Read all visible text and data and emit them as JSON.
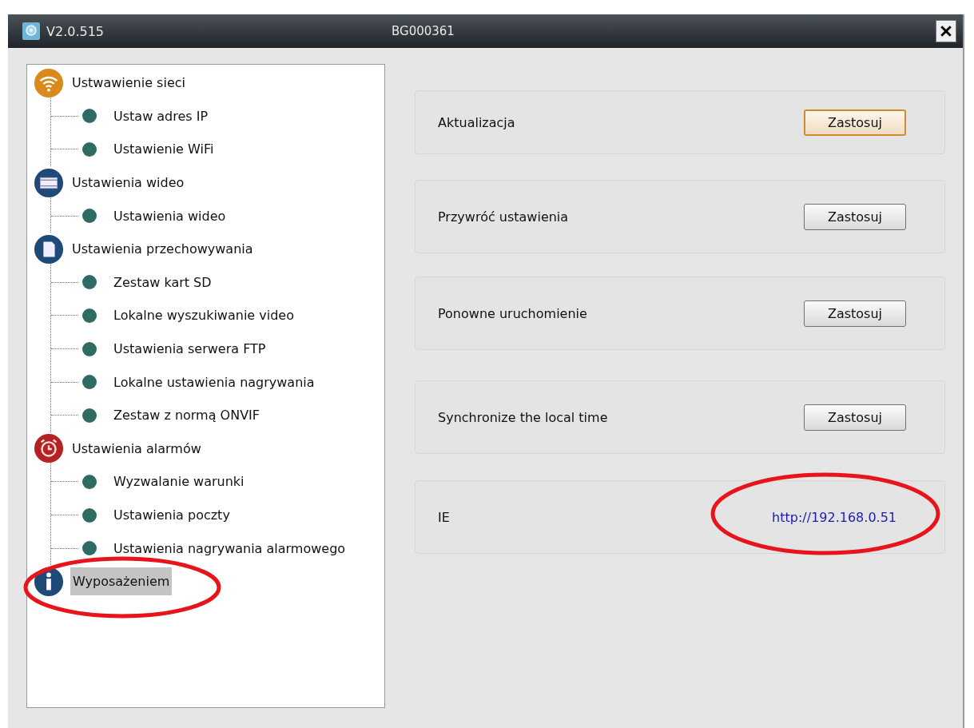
{
  "window": {
    "version": "V2.0.515",
    "device_id": "BG000361"
  },
  "tree": [
    {
      "label": "Ustwawienie sieci",
      "kind": "wifi",
      "selected": false,
      "children": [
        {
          "label": "Ustaw adres IP",
          "selected": false
        },
        {
          "label": "Ustawienie WiFi",
          "selected": false
        }
      ]
    },
    {
      "label": "Ustawienia wideo",
      "kind": "video",
      "selected": false,
      "children": [
        {
          "label": "Ustawienia wideo",
          "selected": false
        }
      ]
    },
    {
      "label": "Ustawienia przechowywania",
      "kind": "storage",
      "selected": false,
      "children": [
        {
          "label": "Zestaw kart SD",
          "selected": false
        },
        {
          "label": "Lokalne wyszukiwanie video",
          "selected": false
        },
        {
          "label": "Ustawienia serwera FTP",
          "selected": false
        },
        {
          "label": "Lokalne ustawienia nagrywania",
          "selected": false
        },
        {
          "label": "Zestaw z normą ONVIF",
          "selected": false
        }
      ]
    },
    {
      "label": "Ustawienia alarmów",
      "kind": "alarm",
      "selected": false,
      "children": [
        {
          "label": "Wyzwalanie warunki",
          "selected": false
        },
        {
          "label": "Ustawienia poczty",
          "selected": false
        },
        {
          "label": "Ustawienia nagrywania alarmowego",
          "selected": false
        }
      ]
    },
    {
      "label": "Wyposażeniem",
      "kind": "info",
      "selected": true
    }
  ],
  "panels": [
    {
      "label": "Aktualizacja",
      "kind": "button",
      "action": "Zastosuj",
      "focused": true
    },
    {
      "label": "Przywróć ustawienia",
      "kind": "button",
      "action": "Zastosuj",
      "focused": false
    },
    {
      "label": "Ponowne uruchomienie",
      "kind": "button",
      "action": "Zastosuj",
      "focused": false
    },
    {
      "label": "Synchronize the local time",
      "kind": "button",
      "action": "Zastosuj",
      "focused": false
    },
    {
      "label": "IE",
      "kind": "link",
      "action": "http://192.168.0.51"
    }
  ]
}
